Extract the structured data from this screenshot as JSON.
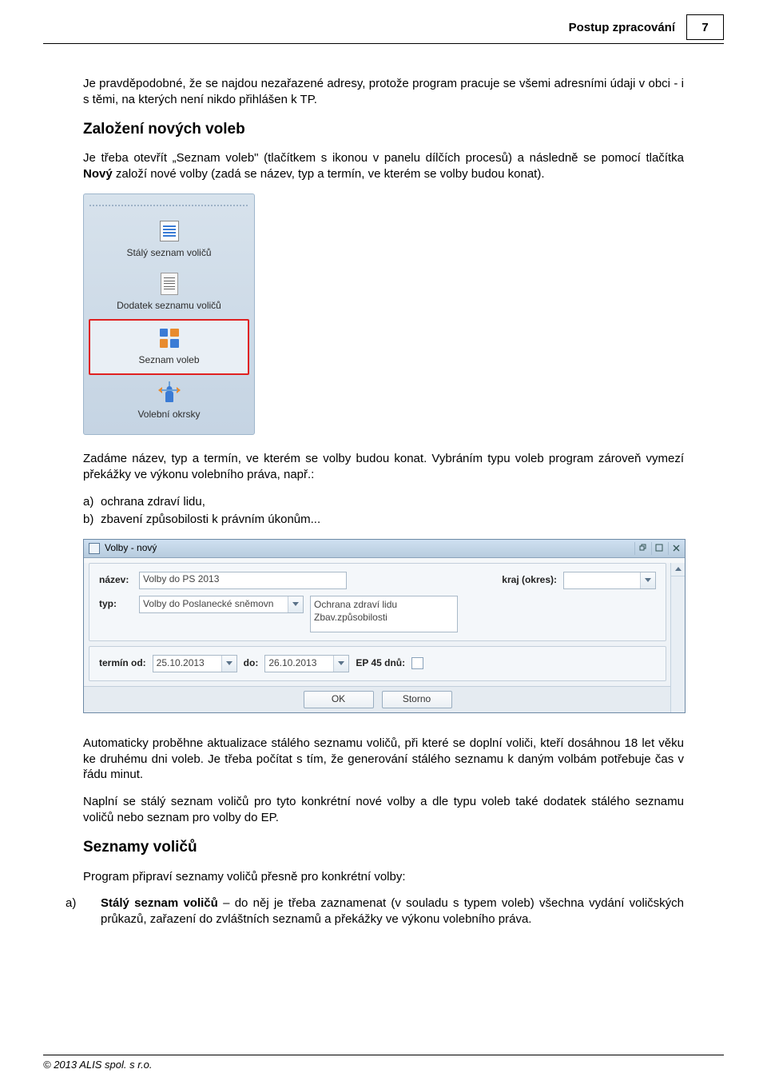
{
  "header": {
    "title": "Postup zpracování",
    "page": "7"
  },
  "para1": "Je pravděpodobné, že se najdou nezařazené adresy, protože program pracuje se všemi  adresními údaji v obci - i s těmi, na kterých není nikdo přihlášen k TP.",
  "h2_1": "Založení nových voleb",
  "para2_pre": "Je třeba otevřít „Seznam voleb\" (tlačítkem s ikonou v panelu dílčích procesů) a následně se pomocí tlačítka ",
  "para2_bold": "Nový",
  "para2_post": " založí nové volby (zadá se název, typ a termín, ve kterém se volby budou konat).",
  "panel": {
    "items": [
      {
        "label": "Stálý seznam voličů",
        "name": "panel-item-staly-seznam"
      },
      {
        "label": "Dodatek seznamu voličů",
        "name": "panel-item-dodatek"
      },
      {
        "label": "Seznam voleb",
        "name": "panel-item-seznam-voleb"
      },
      {
        "label": "Volební okrsky",
        "name": "panel-item-okrsky"
      }
    ]
  },
  "para3": "Zadáme název, typ a termín, ve kterém se volby budou konat. Vybráním typu voleb program zároveň vymezí překážky ve výkonu volebního práva, např.:",
  "list1": {
    "a": "ochrana zdraví lidu,",
    "b": "zbavení způsobilosti k právním úkonům..."
  },
  "dialog": {
    "title": "Volby - nový",
    "nazev_lbl": "název:",
    "nazev_val": "Volby do PS 2013",
    "kraj_lbl": "kraj (okres):",
    "typ_lbl": "typ:",
    "typ_val": "Volby do Poslanecké sněmovn",
    "listbox": [
      "Ochrana zdraví lidu",
      "Zbav.způsobilosti"
    ],
    "termin_od_lbl": "termín od:",
    "termin_od_val": "25.10.2013",
    "do_lbl": "do:",
    "do_val": "26.10.2013",
    "ep_lbl": "EP 45 dnů:",
    "ok": "OK",
    "storno": "Storno"
  },
  "para4": "Automaticky proběhne aktualizace stálého seznamu voličů, při které se doplní voliči, kteří dosáhnou 18 let věku ke druhému dni voleb. Je třeba počítat s tím, že generování stálého seznamu k daným volbám potřebuje čas v řádu minut.",
  "para5": "Naplní se stálý seznam voličů  pro tyto  konkrétní nové volby  a dle typu voleb také dodatek stálého seznamu voličů nebo seznam pro volby do EP.",
  "h2_2": "Seznamy voličů",
  "para6": "Program připraví seznamy voličů přesně pro konkrétní volby:",
  "list2_a_bold": "Stálý seznam voličů",
  "list2_a_rest": " – do něj je třeba zaznamenat (v souladu s typem voleb) všechna vydání voličských průkazů, zařazení do zvláštních seznamů a překážky ve výkonu volebního práva.",
  "footer": "© 2013 ALIS spol. s r.o."
}
